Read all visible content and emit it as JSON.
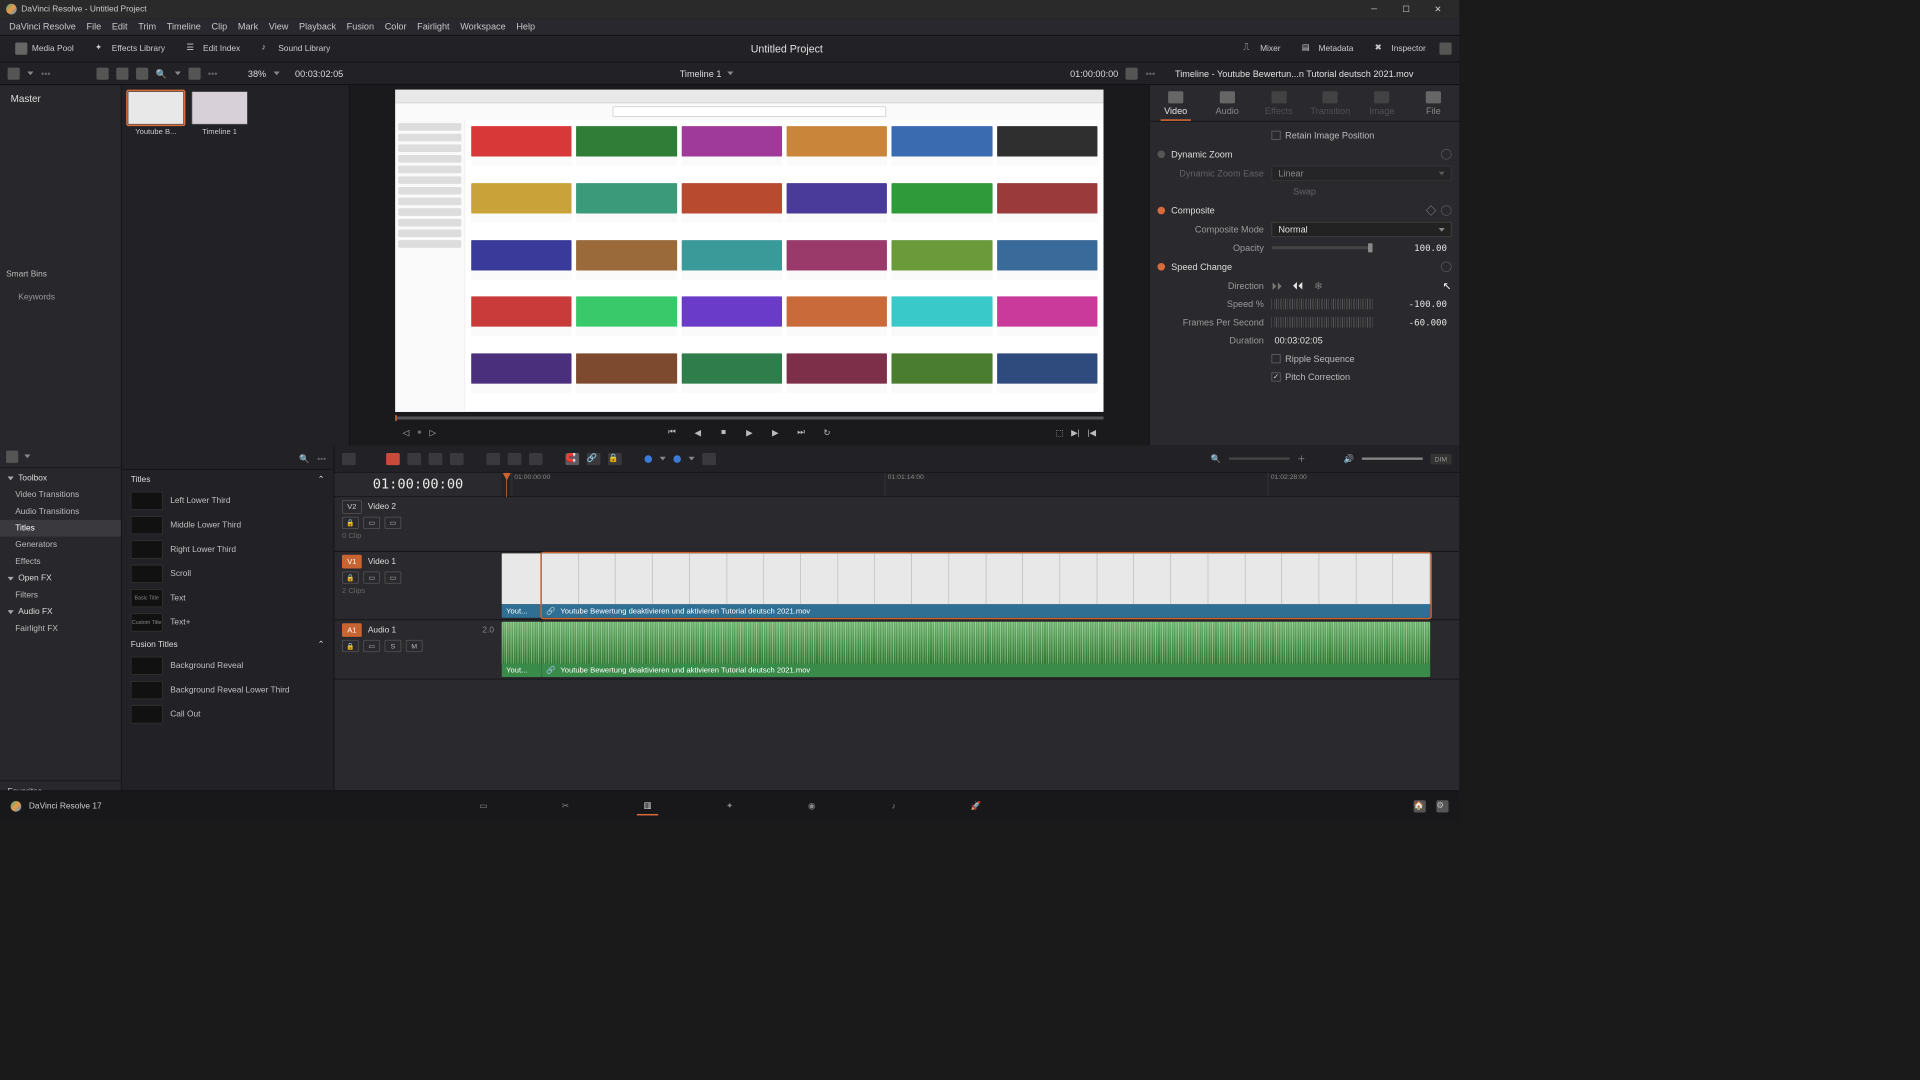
{
  "window": {
    "title": "DaVinci Resolve - Untitled Project"
  },
  "menu": [
    "DaVinci Resolve",
    "File",
    "Edit",
    "Trim",
    "Timeline",
    "Clip",
    "Mark",
    "View",
    "Playback",
    "Fusion",
    "Color",
    "Fairlight",
    "Workspace",
    "Help"
  ],
  "toolbar": {
    "media_pool": "Media Pool",
    "effects": "Effects Library",
    "edit_index": "Edit Index",
    "sound_lib": "Sound Library",
    "project_title": "Untitled Project",
    "mixer": "Mixer",
    "metadata": "Metadata",
    "inspector": "Inspector"
  },
  "subbar": {
    "zoom": "38%",
    "src_timecode": "00:03:02:05",
    "timeline_name": "Timeline 1",
    "record_timecode": "01:00:00:00"
  },
  "media": {
    "master": "Master",
    "smart_bins": "Smart Bins",
    "keywords": "Keywords",
    "clips": [
      {
        "name": "Youtube B..."
      },
      {
        "name": "Timeline 1"
      }
    ]
  },
  "viewer_mock": {
    "yt_colors": [
      "#d93838",
      "#2f7d36",
      "#a03a9a",
      "#c9863a",
      "#3a6ab0",
      "#2f2f2f",
      "#c9a23a",
      "#3a9a7a",
      "#b84a2f",
      "#4a3a9a",
      "#2f9a3a",
      "#9a3a3a",
      "#3a3a9a",
      "#9a6a3a",
      "#3a9a9a",
      "#9a3a6a",
      "#6a9a3a",
      "#3a6a9a",
      "#c93a3a",
      "#3ac96a",
      "#6a3ac9",
      "#c96a3a",
      "#3ac9c9",
      "#c93a9a",
      "#4a2f7d",
      "#7d4a2f",
      "#2f7d4a",
      "#7d2f4a",
      "#4a7d2f",
      "#2f4a7d"
    ]
  },
  "inspector": {
    "title": "Timeline - Youtube Bewertun...n Tutorial deutsch 2021.mov",
    "tabs": [
      "Video",
      "Audio",
      "Effects",
      "Transition",
      "Image",
      "File"
    ],
    "sec1": {
      "retain": "Retain Image Position"
    },
    "dynamic_zoom": {
      "header": "Dynamic Zoom",
      "ease_label": "Dynamic Zoom Ease",
      "ease_value": "Linear",
      "swap": "Swap"
    },
    "composite": {
      "header": "Composite",
      "mode_label": "Composite Mode",
      "mode_value": "Normal",
      "opacity_label": "Opacity",
      "opacity_value": "100.00"
    },
    "speed": {
      "header": "Speed Change",
      "direction_label": "Direction",
      "speed_label": "Speed %",
      "speed_value": "-100.00",
      "fps_label": "Frames Per Second",
      "fps_value": "-60.000",
      "duration_label": "Duration",
      "duration_value": "00:03:02:05",
      "ripple": "Ripple Sequence",
      "pitch": "Pitch Correction"
    }
  },
  "fx": {
    "hdr_search_ph": "Search",
    "groups": {
      "toolbox": "Toolbox",
      "video_trans": "Video Transitions",
      "audio_trans": "Audio Transitions",
      "titles": "Titles",
      "generators": "Generators",
      "effects": "Effects",
      "openfx": "Open FX",
      "filters": "Filters",
      "audiofx": "Audio FX",
      "fairlight": "Fairlight FX"
    },
    "favorites": "Favorites",
    "section_titles": "Titles",
    "section_fusion": "Fusion Titles",
    "items_titles": [
      "Left Lower Third",
      "Middle Lower Third",
      "Right Lower Third",
      "Scroll",
      "Text",
      "Text+"
    ],
    "items_titles_thumbs": [
      "",
      "",
      "",
      "",
      "Basic Title",
      "Custom Title"
    ],
    "items_fusion": [
      "Background Reveal",
      "Background Reveal Lower Third",
      "Call Out"
    ]
  },
  "timeline": {
    "big_tc": "01:00:00:00",
    "ruler_ticks": [
      "01:00:00:00",
      "01:01:14:00",
      "01:02:28:00"
    ],
    "tracks": {
      "v2": {
        "badge": "V2",
        "name": "Video 2",
        "meta": "0 Clip"
      },
      "v1": {
        "badge": "V1",
        "name": "Video 1",
        "meta": "2 Clips"
      },
      "a1": {
        "badge": "A1",
        "name": "Audio 1",
        "ch": "2.0",
        "s": "S",
        "m": "M"
      }
    },
    "clip1_short": "Yout...",
    "clip1_name": "Youtube Bewertung deaktivieren und aktivieren Tutorial deutsch 2021.mov"
  },
  "footer": {
    "version": "DaVinci Resolve 17"
  }
}
